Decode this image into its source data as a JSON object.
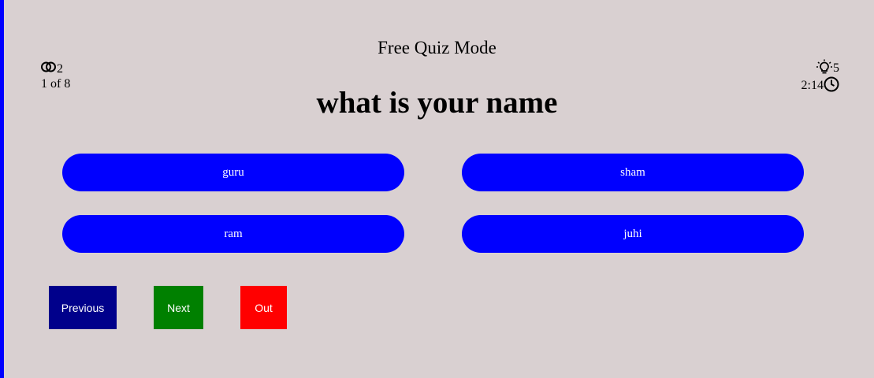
{
  "header": {
    "title": "Free Quiz Mode"
  },
  "stats": {
    "score_icon": "overlapping-circles-icon",
    "score": "2",
    "progress": "1 of 8",
    "hints_icon": "lightbulb-icon",
    "hints": "5",
    "timer_icon": "clock-icon",
    "time": "2:14"
  },
  "question": {
    "text": "what is your name"
  },
  "options": [
    {
      "label": "guru"
    },
    {
      "label": "sham"
    },
    {
      "label": "ram"
    },
    {
      "label": "juhi"
    }
  ],
  "nav": {
    "previous_label": "Previous",
    "next_label": "Next",
    "out_label": "Out"
  },
  "colors": {
    "background": "#d9d0d1",
    "accent": "#0000ff",
    "previous": "#00008b",
    "next": "#008000",
    "out": "#ff0000"
  }
}
